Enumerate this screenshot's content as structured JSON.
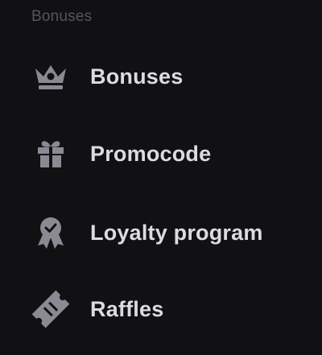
{
  "section": {
    "title": "Bonuses"
  },
  "menu": {
    "items": [
      {
        "label": "Bonuses",
        "icon": "crown-icon"
      },
      {
        "label": "Promocode",
        "icon": "gift-icon"
      },
      {
        "label": "Loyalty program",
        "icon": "award-badge-icon"
      },
      {
        "label": "Raffles",
        "icon": "ticket-icon"
      }
    ]
  },
  "colors": {
    "background": "#111114",
    "icon": "#8a8b92",
    "label": "#dcdce0",
    "section_title": "#55565c"
  }
}
